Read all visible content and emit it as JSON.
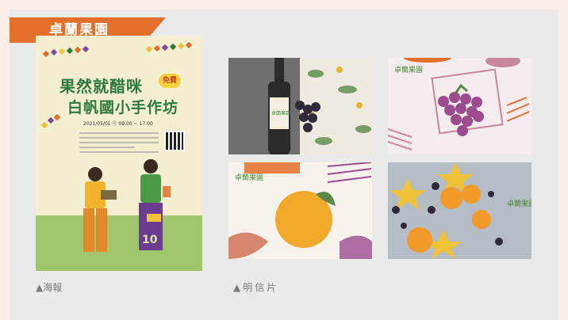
{
  "tab": {
    "label": "卓蘭果園"
  },
  "poster": {
    "title_line1": "果然就醋咪",
    "title_line2": "白帆國小手作坊",
    "badge": "免費",
    "date": "2021/05/01 ⓔ 09:00 ~ 17:00",
    "shirt_number": "10",
    "logo_text": "卓蘭果園"
  },
  "postcards": {
    "logo_text": "卓蘭果園"
  },
  "captions": {
    "poster": "▲海報",
    "postcard": "▲明信片"
  },
  "colors": {
    "tab_orange": "#e46f2a",
    "title_green": "#2d7b3c",
    "badge_yellow": "#f5d13b",
    "grape_purple": "#9a4c8f"
  }
}
